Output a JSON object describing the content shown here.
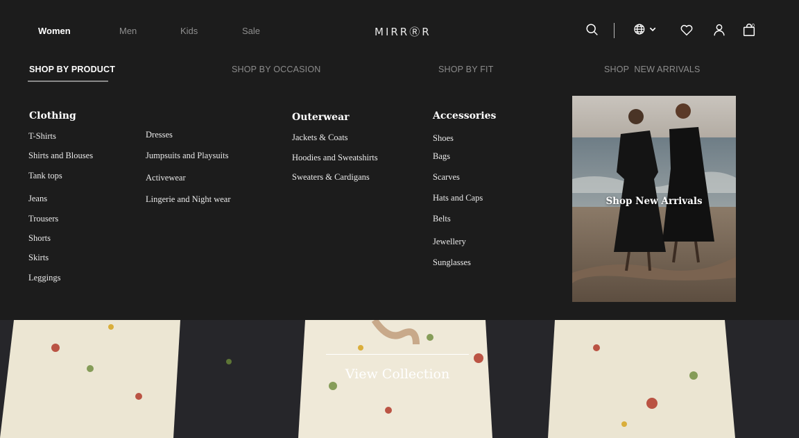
{
  "nav": {
    "items": [
      "Women",
      "Men",
      "Kids",
      "Sale"
    ],
    "active": "Women",
    "logo": "MIRRⓇR"
  },
  "header_icons": {
    "search": "search-icon",
    "language": "globe-icon",
    "wishlist": "heart-icon",
    "account": "user-icon",
    "bag": "shopping-bag-icon",
    "bag_count": "0"
  },
  "tabs": [
    "SHOP BY PRODUCT",
    "SHOP BY OCCASION",
    "SHOP BY FIT",
    "SHOP  NEW ARRIVALS"
  ],
  "active_tab": "SHOP BY PRODUCT",
  "menu": {
    "clothing": {
      "heading": "Clothing",
      "col1": [
        "T-Shirts",
        "Shirts and Blouses",
        "Tank tops",
        "Jeans",
        "Trousers",
        "Shorts",
        "Skirts",
        "Leggings"
      ],
      "col2": [
        "Dresses",
        "Jumpsuits and Playsuits",
        "Activewear",
        "Lingerie and Night wear"
      ]
    },
    "outerwear": {
      "heading": "Outerwear",
      "items": [
        "Jackets & Coats",
        "Hoodies and Sweatshirts",
        "Sweaters & Cardigans"
      ]
    },
    "accessories": {
      "heading": "Accessories",
      "items": [
        "Shoes",
        "Bags",
        "Scarves",
        "Hats and Caps",
        "Belts",
        "Jewellery",
        "Sunglasses"
      ]
    }
  },
  "promo": {
    "label": "Shop New Arrivals"
  },
  "hero": {
    "cta": "View Collection"
  },
  "colors": {
    "background": "#1c1c1c",
    "text": "#ffffff",
    "muted": "#8c8c8c"
  }
}
